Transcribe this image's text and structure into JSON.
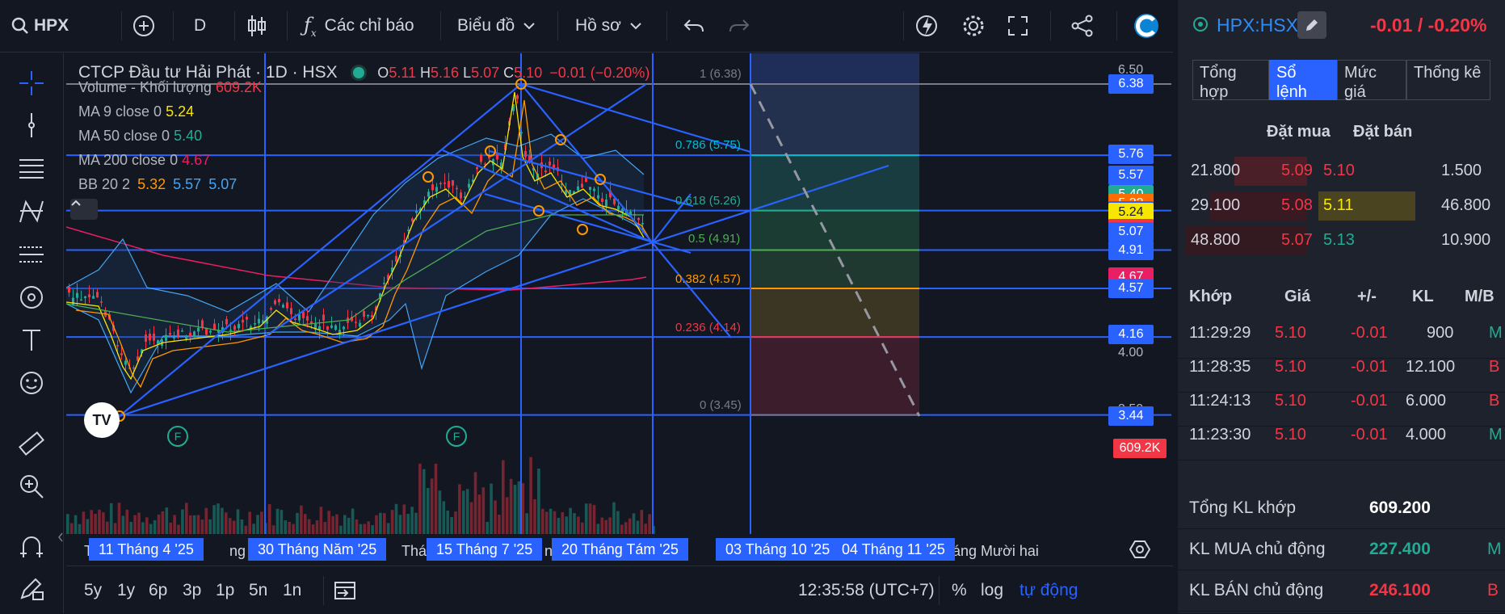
{
  "toolbar": {
    "symbol": "HPX",
    "interval": "D",
    "indicators": "Các chỉ báo",
    "chart_menu": "Biểu đồ",
    "profile_menu": "Hồ sơ"
  },
  "legend": {
    "title": "CTCP Đầu tư Hải Phát · 1D · HSX",
    "o_label": "O",
    "o": "5.11",
    "h_label": "H",
    "h": "5.16",
    "l_label": "L",
    "l": "5.07",
    "c_label": "C",
    "c": "5.10",
    "change": "−0.01 (−0.20%)",
    "volume_label": "Volume - Khối lượng",
    "volume": "609.2K",
    "ma9_label": "MA 9 close 0",
    "ma9": "5.24",
    "ma50_label": "MA 50 close 0",
    "ma50": "5.40",
    "ma200_label": "MA 200 close 0",
    "ma200": "4.67",
    "bb_label": "BB 20 2",
    "bb_mid": "5.32",
    "bb_up": "5.57",
    "bb_low": "5.07"
  },
  "fib_labels": [
    "1 (6.38)",
    "0.786 (5.75)",
    "0.618 (5.26)",
    "0.5 (4.91)",
    "0.382 (4.57)",
    "0.236 (4.14)",
    "0 (3.45)"
  ],
  "price_scale": {
    "ticks": [
      "6.50",
      "4.00",
      "3.50"
    ],
    "badges": [
      {
        "text": "6.38",
        "color": "#2962ff",
        "fg": "#ffffff"
      },
      {
        "text": "5.76",
        "color": "#2962ff",
        "fg": "#ffffff"
      },
      {
        "text": "5.57",
        "color": "#2962ff",
        "fg": "#ffffff"
      },
      {
        "text": "5.40",
        "color": "#22ab94",
        "fg": "#ffffff"
      },
      {
        "text": "5.32",
        "color": "#ff6d00",
        "fg": "#ffffff"
      },
      {
        "text": "5.26",
        "color": "#2962ff",
        "fg": "#ffffff"
      },
      {
        "text": "5.24",
        "color": "#f7e600",
        "fg": "#131722"
      },
      {
        "text": "5.10",
        "color": "#f23645",
        "fg": "#ffffff"
      },
      {
        "text": "5.07",
        "color": "#2962ff",
        "fg": "#ffffff"
      },
      {
        "text": "4.91",
        "color": "#2962ff",
        "fg": "#ffffff"
      },
      {
        "text": "4.67",
        "color": "#e91e63",
        "fg": "#ffffff"
      },
      {
        "text": "4.57",
        "color": "#2962ff",
        "fg": "#ffffff"
      },
      {
        "text": "4.16",
        "color": "#2962ff",
        "fg": "#ffffff"
      },
      {
        "text": "3.44",
        "color": "#2962ff",
        "fg": "#ffffff"
      },
      {
        "text": "609.2K",
        "color": "#f23645",
        "fg": "#ffffff"
      }
    ]
  },
  "time_axis": {
    "labels": [
      "11 Tháng 4 '25",
      "30 Tháng Năm '25",
      "15 Tháng 7 '25",
      "20 Tháng Tám '25",
      "03 Tháng 10 '25",
      "04 Tháng 11 '25"
    ],
    "partial_left": "T",
    "partial_1": "ng Năm",
    "partial_2": "Thá",
    "partial_3": "ng",
    "partial_4": "háng Mười hai"
  },
  "bottom": {
    "ranges": [
      "5y",
      "1y",
      "6p",
      "3p",
      "1p",
      "5n",
      "1n"
    ],
    "clock": "12:35:58 (UTC+7)",
    "percent": "%",
    "log": "log",
    "auto": "tự động"
  },
  "panel": {
    "symbol": "HPX:HSX",
    "change": "-0.01 / -0.20%",
    "tabs": [
      "Tổng hợp",
      "Sổ lệnh",
      "Mức giá",
      "Thống kê"
    ],
    "ob_header_buy": "Đặt mua",
    "ob_header_sell": "Đặt bán",
    "orderbook": [
      {
        "bid_vol": "21.800",
        "bid": "5.09",
        "ask": "5.10",
        "ask_vol": "1.500"
      },
      {
        "bid_vol": "29.100",
        "bid": "5.08",
        "ask": "5.11",
        "ask_vol": "46.800"
      },
      {
        "bid_vol": "48.800",
        "bid": "5.07",
        "ask": "5.13",
        "ask_vol": "10.900"
      }
    ],
    "trade_headers": [
      "Khớp",
      "Giá",
      "+/-",
      "KL",
      "M/B"
    ],
    "trades": [
      {
        "time": "11:29:29",
        "price": "5.10",
        "chg": "-0.01",
        "vol": "900",
        "side": "M"
      },
      {
        "time": "11:28:35",
        "price": "5.10",
        "chg": "-0.01",
        "vol": "12.100",
        "side": "B"
      },
      {
        "time": "11:24:13",
        "price": "5.10",
        "chg": "-0.01",
        "vol": "6.000",
        "side": "B"
      },
      {
        "time": "11:23:30",
        "price": "5.10",
        "chg": "-0.01",
        "vol": "4.000",
        "side": "M"
      }
    ],
    "stats": [
      {
        "label": "Tổng KL khớp",
        "value": "609.200",
        "tag": ""
      },
      {
        "label": "KL MUA chủ động",
        "value": "227.400",
        "tag": "M"
      },
      {
        "label": "KL BÁN chủ động",
        "value": "246.100",
        "tag": "B"
      }
    ]
  },
  "colors": {
    "accent": "#2962ff",
    "up": "#22ab94",
    "down": "#f23645",
    "bg": "#131722",
    "panel": "#1e222d"
  }
}
